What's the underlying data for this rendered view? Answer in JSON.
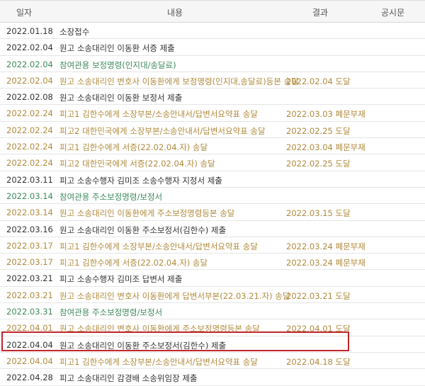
{
  "columns": {
    "date": "일자",
    "content": "내용",
    "result": "결과",
    "notice": "공시문"
  },
  "colors": {
    "header_bg": "#f6f6f6",
    "black": "#333333",
    "gold": "#b08a3c",
    "green": "#3e8a5c",
    "highlight": "#c0262c"
  },
  "rows": [
    {
      "date": "2022.01.18",
      "content": "소장접수",
      "result": "",
      "style": "black"
    },
    {
      "date": "2022.02.04",
      "content": "원고 소송대리인 이동환 서증 제출",
      "result": "",
      "style": "black"
    },
    {
      "date": "2022.02.04",
      "content": "참여관용 보정명령(인지대/송달료)",
      "result": "",
      "style": "green"
    },
    {
      "date": "2022.02.04",
      "content": "원고 소송대리인 변호사 이동환에게 보정명령(인지대,송달료)등본 송달",
      "result": "2022.02.04 도달",
      "style": "gold"
    },
    {
      "date": "2022.02.08",
      "content": "원고 소송대리인 이동환 보정서 제출",
      "result": "",
      "style": "black"
    },
    {
      "date": "2022.02.24",
      "content": "피고1 김한수에게 소장부본/소송안내서/답변서요약표 송달",
      "result": "2022.03.03 폐문부재",
      "style": "gold"
    },
    {
      "date": "2022.02.24",
      "content": "피고2 대한민국에게 소장부본/소송안내서/답변서요약표 송달",
      "result": "2022.02.25 도달",
      "style": "gold"
    },
    {
      "date": "2022.02.24",
      "content": "피고1 김한수에게 서증(22.02.04.자) 송달",
      "result": "2022.03.04 폐문부재",
      "style": "gold"
    },
    {
      "date": "2022.02.24",
      "content": "피고2 대한민국에게 서증(22.02.04.자) 송달",
      "result": "2022.02.25 도달",
      "style": "gold"
    },
    {
      "date": "2022.03.11",
      "content": "피고 소송수행자 김미조 소송수행자 지정서 제출",
      "result": "",
      "style": "black"
    },
    {
      "date": "2022.03.14",
      "content": "참여관용 주소보정명령/보정서",
      "result": "",
      "style": "green"
    },
    {
      "date": "2022.03.14",
      "content": "원고 소송대리인 이동환에게 주소보정명령등본 송달",
      "result": "2022.03.15 도달",
      "style": "gold"
    },
    {
      "date": "2022.03.16",
      "content": "원고 소송대리인 이동환 주소보정서(김한수) 제출",
      "result": "",
      "style": "black"
    },
    {
      "date": "2022.03.17",
      "content": "피고1 김한수에게 소장부본/소송안내서/답변서요약표 송달",
      "result": "2022.03.24 폐문부재",
      "style": "gold"
    },
    {
      "date": "2022.03.17",
      "content": "피고1 김한수에게 서증(22.02.04.자) 송달",
      "result": "2022.03.24 폐문부재",
      "style": "gold"
    },
    {
      "date": "2022.03.21",
      "content": "피고 소송수행자 김미조 답변서 제출",
      "result": "",
      "style": "black"
    },
    {
      "date": "2022.03.21",
      "content": "원고 소송대리인 변호사 이동환에게 답변서부본(22.03.21.자) 송달",
      "result": "2022.03.21 도달",
      "style": "gold"
    },
    {
      "date": "2022.03.31",
      "content": "참여관용 주소보정명령/보정서",
      "result": "",
      "style": "green"
    },
    {
      "date": "2022.04.01",
      "content": "원고 소송대리인 변호사 이동환에게 주소보정명령등본 송달",
      "result": "2022.04.01 도달",
      "style": "gold"
    },
    {
      "date": "2022.04.04",
      "content": "원고 소송대리인 이동환 주소보정서(김한수) 제출",
      "result": "",
      "style": "black"
    },
    {
      "date": "2022.04.04",
      "content": "피고1 김한수에게 소장부본/소송안내서/답변서요약표 송달",
      "result": "2022.04.18 도달",
      "style": "gold"
    },
    {
      "date": "2022.04.28",
      "content": "피고 소송대리인 감경배 소송위임장 제출",
      "result": "",
      "style": "black"
    }
  ]
}
